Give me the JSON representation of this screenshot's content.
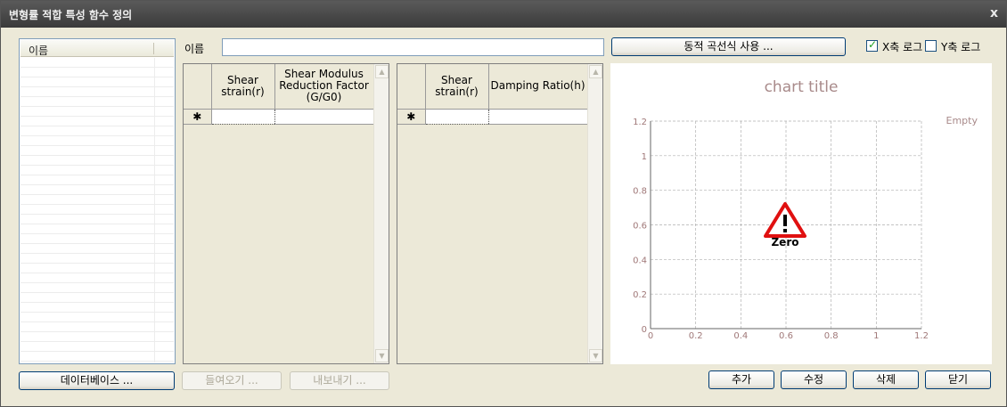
{
  "window": {
    "title": "변형률 적합 특성 함수 정의",
    "close_glyph": "x"
  },
  "list": {
    "header": "이름",
    "rows": []
  },
  "name_field": {
    "label": "이름",
    "value": ""
  },
  "dynamic_curve_button": "동적 곡선식 사용 ...",
  "x_log": {
    "label": "X축 로그",
    "checked": true,
    "mark": "✓"
  },
  "y_log": {
    "label": "Y축 로그",
    "checked": false
  },
  "modulus_grid": {
    "columns": [
      "Shear strain(r)",
      "Shear Modulus Reduction Factor (G/G0)"
    ],
    "new_row_marker": "✱"
  },
  "damping_grid": {
    "columns": [
      "Shear strain(r)",
      "Damping Ratio(h)"
    ],
    "new_row_marker": "✱"
  },
  "scroll": {
    "up_glyph": "▲",
    "down_glyph": "▼"
  },
  "chart": {
    "title": "chart title",
    "empty_label": "Empty",
    "warning_label": "Zero",
    "warning_icon": "warning-triangle-icon",
    "colors": {
      "title": "#a88a8a",
      "grid": "#b0b0b0",
      "warning": "#e01010"
    }
  },
  "chart_data": {
    "type": "line",
    "title": "chart title",
    "series": [],
    "xlim": [
      0,
      1.2
    ],
    "ylim": [
      0,
      1.2
    ],
    "x_ticks": [
      "0",
      "0.2",
      "0.4",
      "0.6",
      "0.8",
      "1",
      "1.2"
    ],
    "y_ticks": [
      "0",
      "0.2",
      "0.4",
      "0.6",
      "0.8",
      "1",
      "1.2"
    ],
    "grid": true,
    "legend": "top-right",
    "empty_text": "Empty",
    "annotation": "Zero"
  },
  "buttons": {
    "database": "데이터베이스 ...",
    "import": "들여오기 ...",
    "export": "내보내기 ...",
    "add": "추가",
    "modify": "수정",
    "delete": "삭제",
    "close": "닫기"
  }
}
